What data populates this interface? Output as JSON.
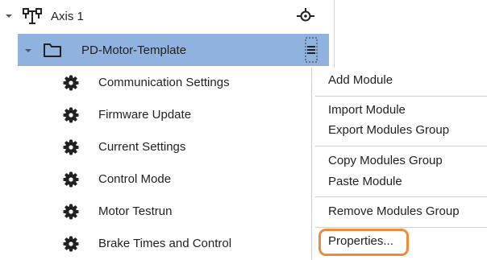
{
  "tree": {
    "axis": {
      "label": "Axis 1",
      "icon": "axis-structure-icon",
      "right_icon": "target-probe-icon"
    },
    "template": {
      "label": "PD-Motor-Template",
      "icon": "folder-icon",
      "right_icon": "drag-handle-icon"
    },
    "children": [
      {
        "label": "Communication Settings",
        "icon": "gear-icon"
      },
      {
        "label": "Firmware Update",
        "icon": "gear-icon"
      },
      {
        "label": "Current Settings",
        "icon": "gear-icon"
      },
      {
        "label": "Control Mode",
        "icon": "gear-icon"
      },
      {
        "label": "Motor Testrun",
        "icon": "gear-icon"
      },
      {
        "label": "Brake Times and Control",
        "icon": "gear-icon"
      }
    ]
  },
  "context_menu": {
    "add_module": "Add Module",
    "import_module": "Import Module",
    "export_modules_group": "Export Modules Group",
    "copy_modules_group": "Copy Modules Group",
    "paste_module": "Paste Module",
    "remove_modules_group": "Remove Modules Group",
    "properties": "Properties..."
  },
  "colors": {
    "selection": "#8fb3de",
    "highlight": "#f08a3c"
  }
}
